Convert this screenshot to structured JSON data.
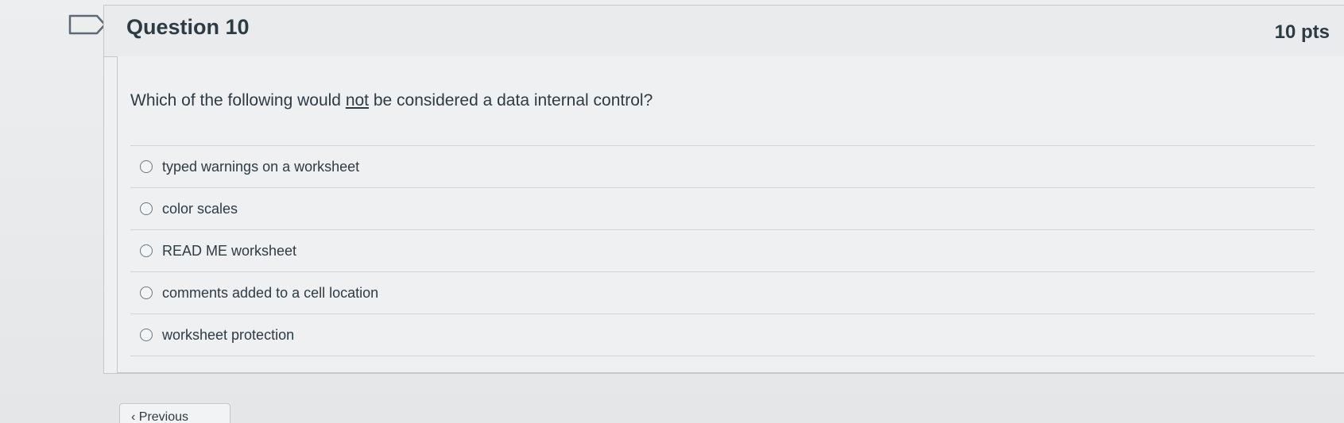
{
  "question": {
    "title": "Question 10",
    "points": "10 pts",
    "prompt_before": "Which of the following would ",
    "prompt_emphasis": "not",
    "prompt_after": " be considered a data internal control?",
    "answers": [
      {
        "label": "typed warnings on a worksheet",
        "selected": false
      },
      {
        "label": "color scales",
        "selected": false
      },
      {
        "label": "READ ME worksheet",
        "selected": false
      },
      {
        "label": "comments added to a cell location",
        "selected": false
      },
      {
        "label": "worksheet protection",
        "selected": false
      }
    ]
  },
  "navigation": {
    "previous_label": "‹ Previous"
  }
}
